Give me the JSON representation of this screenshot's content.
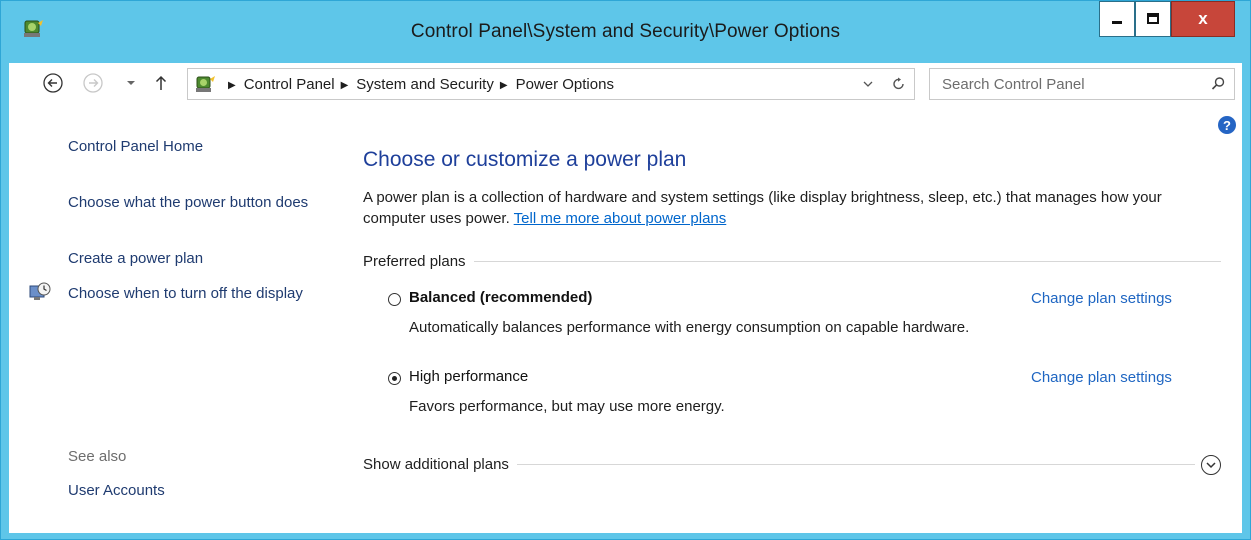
{
  "window": {
    "title": "Control Panel\\System and Security\\Power Options",
    "buttons": {
      "minimize": "▬",
      "maximize": "◻",
      "close": "x"
    }
  },
  "toolbar": {
    "breadcrumbs": [
      "Control Panel",
      "System and Security",
      "Power Options"
    ],
    "search_placeholder": "Search Control Panel"
  },
  "sidebar": {
    "home": "Control Panel Home",
    "links": [
      {
        "label": "Choose what the power button does"
      },
      {
        "label": "Create a power plan"
      },
      {
        "label": "Choose when to turn off the display",
        "icon": "clock-monitor-icon"
      }
    ],
    "see_also_label": "See also",
    "see_also": [
      "User Accounts"
    ]
  },
  "main": {
    "heading": "Choose or customize a power plan",
    "description": "A power plan is a collection of hardware and system settings (like display brightness, sleep, etc.) that manages how your computer uses power.",
    "description_link": "Tell me more about power plans",
    "preferred_label": "Preferred plans",
    "plans": [
      {
        "name": "Balanced (recommended)",
        "selected": false,
        "bold": true,
        "description": "Automatically balances performance with energy consumption on capable hardware.",
        "link": "Change plan settings"
      },
      {
        "name": "High performance",
        "selected": true,
        "bold": false,
        "description": "Favors performance, but may use more energy.",
        "link": "Change plan settings"
      }
    ],
    "additional_label": "Show additional plans"
  },
  "colors": {
    "frame": "#5ec6e9",
    "link": "#1f66c2",
    "heading": "#1e3f9a",
    "close": "#c7463a"
  }
}
